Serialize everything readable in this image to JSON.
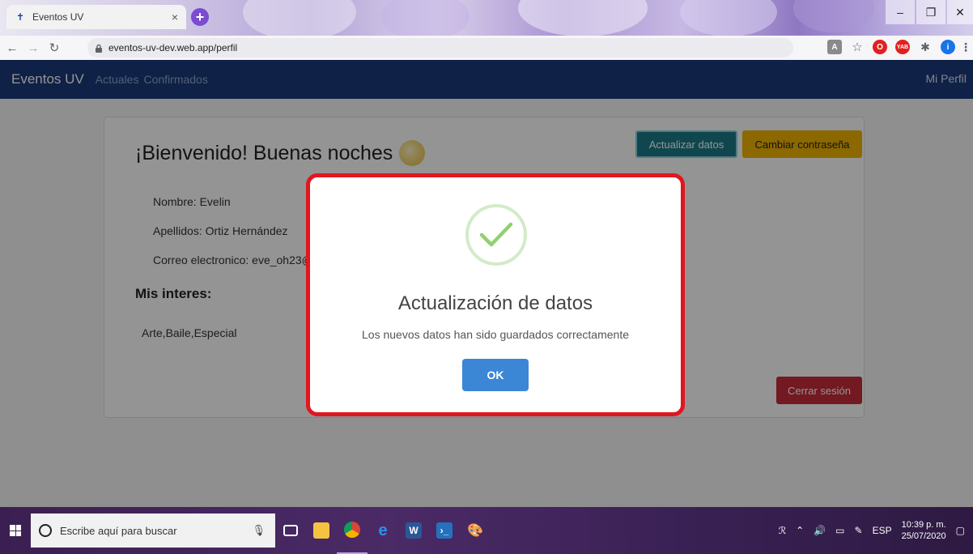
{
  "browser": {
    "tab_title": "Eventos UV",
    "tab_close": "×",
    "new_tab": "+",
    "url": "eventos-uv-dev.web.app/perfil",
    "win_minimize": "–",
    "win_restore": "❐",
    "win_close": "✕"
  },
  "nav": {
    "brand": "Eventos UV",
    "links": [
      "Actuales",
      "Confirmados"
    ],
    "right": "Mi Perfil"
  },
  "profile": {
    "greeting": "¡Bienvenido! Buenas noches",
    "nombre": "Nombre: Evelin",
    "apellidos": "Apellidos: Ortiz Hernández",
    "correo": "Correo electronico: eve_oh23@",
    "interests_heading": "Mis interes:",
    "interests": "Arte,Baile,Especial",
    "update_button": "Actualizar datos",
    "password_button": "Cambiar contraseña",
    "logout_button": "Cerrar sesión"
  },
  "modal": {
    "title": "Actualización de datos",
    "message": "Los nuevos datos han sido guardados correctamente",
    "ok": "OK",
    "highlight_color": "#e2161f",
    "success_color": "#8fd16f"
  },
  "taskbar": {
    "search_placeholder": "Escribe aquí para buscar",
    "language": "ESP",
    "time": "10:39 p. m.",
    "date": "25/07/2020"
  }
}
